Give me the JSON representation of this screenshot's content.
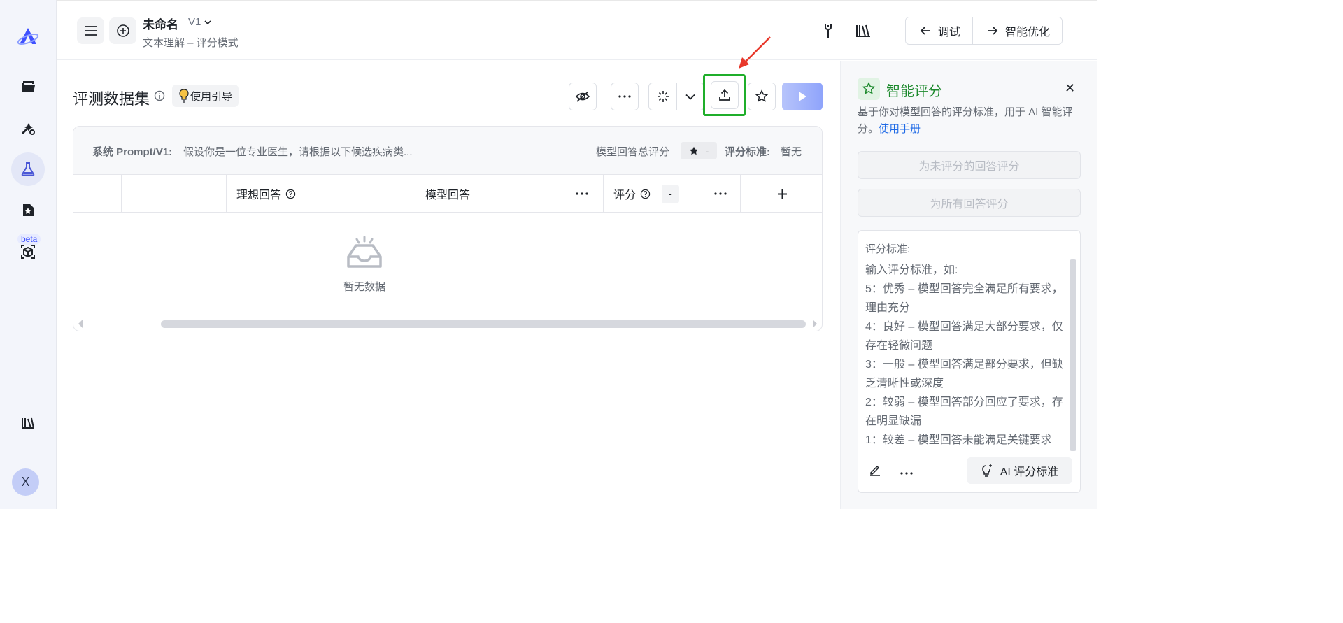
{
  "header": {
    "title": "未命名",
    "version": "V1",
    "subtitle": "文本理解 – 评分模式",
    "debug_label": "调试",
    "optimize_label": "智能优化"
  },
  "rail": {
    "beta_label": "beta",
    "avatar_initial": "X"
  },
  "dataset": {
    "title": "评测数据集",
    "guide_label": "使用引导",
    "system_prompt_label": "系统 Prompt/V1:",
    "system_prompt_text": "假设你是一位专业医生，请根据以下候选疾病类...",
    "total_score_label": "模型回答总评分",
    "total_score_value": "-",
    "criteria_label": "评分标准:",
    "criteria_value": "暂无",
    "columns": {
      "ideal_answer": "理想回答",
      "model_answer": "模型回答",
      "score": "评分",
      "score_value": "-"
    },
    "empty_text": "暂无数据"
  },
  "panel": {
    "title": "智能评分",
    "desc": "基于你对模型回答的评分标准，用于 AI 智能评分。",
    "manual_link": "使用手册",
    "btn_unscored": "为未评分的回答评分",
    "btn_all": "为所有回答评分",
    "criteria_header": "评分标准:",
    "criteria_lines": [
      "输入评分标准，如:",
      "5：优秀 – 模型回答完全满足所有要求，理由充分",
      "4：良好 – 模型回答满足大部分要求，仅存在轻微问题",
      "3：一般 – 模型回答满足部分要求，但缺乏清晰性或深度",
      "2：较弱 – 模型回答部分回应了要求，存在明显缺漏",
      "1：较差 – 模型回答未能满足关键要求"
    ],
    "ai_btn": "AI 评分标准"
  },
  "colors": {
    "accent": "#3f51ff",
    "highlight": "#1fae2a",
    "panel_title": "#1e8a2e",
    "link": "#1f6ae6"
  }
}
